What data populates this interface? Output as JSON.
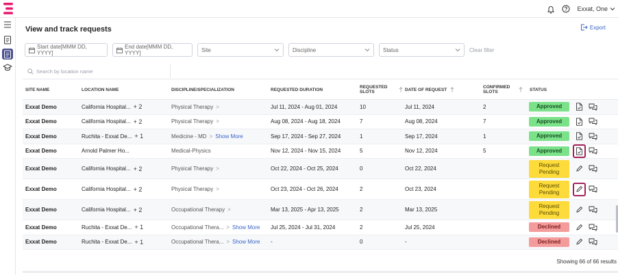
{
  "app": {
    "user_name": "Exxat, One",
    "brand_colors": {
      "logo": "#e8196e",
      "accent": "#3a64c8",
      "sidebar_active": "#4a4f8e"
    }
  },
  "header": {
    "title": "View and track requests",
    "export_label": "Export"
  },
  "filters": {
    "start_date_placeholder": "Start date[MMM DD, YYYY]",
    "end_date_placeholder": "End date[MMM DD, YYYY]",
    "site_label": "Site",
    "discipline_label": "Discipline",
    "status_label": "Status",
    "clear_label": "Clear filter"
  },
  "search": {
    "placeholder": "Search by location name",
    "value": ""
  },
  "table": {
    "columns": {
      "site": "SITE NAME",
      "location": "LOCATION NAME",
      "discipline": "DISCIPLINE/SPECIALIZATION",
      "duration": "REQUESTED DURATION",
      "requested_line1": "REQUESTED",
      "requested_line2": "SLOTS",
      "date": "DATE OF REQUEST",
      "confirmed_line1": "CONFIRMED",
      "confirmed_line2": "SLOTS",
      "status": "STATUS"
    },
    "show_more_label": "Show More",
    "rows": [
      {
        "site": "Exxat Demo",
        "location": "California Hospital...",
        "extra": "+ 2",
        "discipline": "Physical Therapy",
        "duration": "Jul 11, 2024  - Aug 01, 2024",
        "requested": "10",
        "date": "Jul 11, 2024",
        "confirmed": "2",
        "status": "Approved"
      },
      {
        "site": "Exxat Demo",
        "location": "California Hospital...",
        "extra": "+ 2",
        "discipline": "Physical Therapy",
        "duration": "Aug 08, 2024  - Aug 18, 2024",
        "requested": "7",
        "date": "Aug 08, 2024",
        "confirmed": "7",
        "status": "Approved"
      },
      {
        "site": "Exxat Demo",
        "location": "Ruchita - Exxat De...",
        "extra": "+ 1",
        "discipline": "Medicine - MD",
        "duration": "Sep 17, 2024  - Sep 27, 2024",
        "requested": "1",
        "date": "Sep 17, 2024",
        "confirmed": "1",
        "status": "Approved"
      },
      {
        "site": "Exxat Demo",
        "location": "Arnold Palmer Ho...",
        "extra": "",
        "discipline": "Medical-Physics",
        "duration": "Nov 12, 2024  - Nov 15, 2024",
        "requested": "5",
        "date": "Nov 12, 2024",
        "confirmed": "5",
        "status": "Approved"
      },
      {
        "site": "Exxat Demo",
        "location": "California Hospital...",
        "extra": "+ 2",
        "discipline": "Physical Therapy",
        "duration": "Oct 22, 2024  - Oct 25, 2024",
        "requested": "0",
        "date": "Oct 22, 2024",
        "confirmed": "",
        "status_line1": "Request",
        "status_line2": "Pending"
      },
      {
        "site": "Exxat Demo",
        "location": "California Hospital...",
        "extra": "+ 2",
        "discipline": "Physical Therapy",
        "duration": "Oct 23, 2024  - Oct 26, 2024",
        "requested": "2",
        "date": "Oct 23, 2024",
        "confirmed": "",
        "status_line1": "Request",
        "status_line2": "Pending"
      },
      {
        "site": "Exxat Demo",
        "location": "California Hospital...",
        "extra": "+ 2",
        "discipline": "Occupational Therapy",
        "duration": "Mar 13, 2025  - Apr 13, 2025",
        "requested": "2",
        "date": "Mar 13, 2025",
        "confirmed": "",
        "status_line1": "Request",
        "status_line2": "Pending"
      },
      {
        "site": "Exxat Demo",
        "location": "Ruchita - Exxat De...",
        "extra": "+ 1",
        "discipline": "Occupational Thera...",
        "duration": "Jul 25, 2024  - Jul 31, 2024",
        "requested": "2",
        "date": "Jul 25, 2024",
        "confirmed": "",
        "status": "Declined"
      },
      {
        "site": "Exxat Demo",
        "location": "Ruchita - Exxat De...",
        "extra": "+ 1",
        "discipline": "Occupational Thera...",
        "duration": "-",
        "requested": "0",
        "date": "-",
        "confirmed": "",
        "status": "Declined"
      }
    ]
  },
  "footer": {
    "results_text": "Showing 66 of 66 results"
  }
}
